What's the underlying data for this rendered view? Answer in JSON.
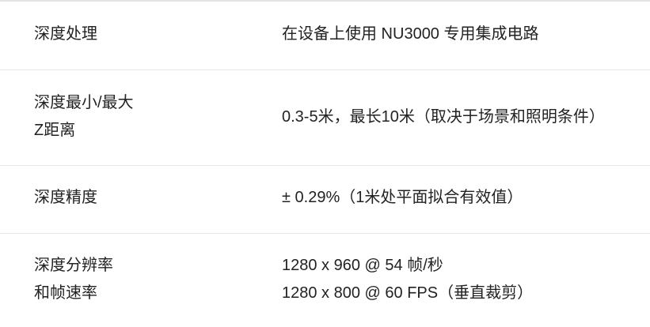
{
  "specs": [
    {
      "label_lines": [
        "深度处理"
      ],
      "value_lines": [
        "在设备上使用 NU3000 专用集成电路"
      ]
    },
    {
      "label_lines": [
        "深度最小/最大",
        "Z距离"
      ],
      "value_lines": [
        "0.3-5米，最长10米（取决于场景和照明条件）"
      ]
    },
    {
      "label_lines": [
        "深度精度"
      ],
      "value_lines": [
        "± 0.29%（1米处平面拟合有效值）"
      ]
    },
    {
      "label_lines": [
        "深度分辨率",
        "和帧速率"
      ],
      "value_lines": [
        "1280 x 960 @ 54 帧/秒",
        "1280 x 800 @ 60 FPS（垂直裁剪）"
      ]
    }
  ]
}
